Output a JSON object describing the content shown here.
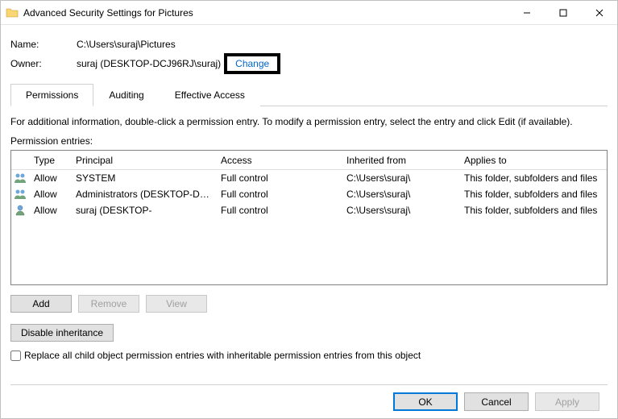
{
  "titlebar": {
    "title": "Advanced Security Settings for Pictures"
  },
  "info": {
    "name_label": "Name:",
    "name_value": "C:\\Users\\suraj\\Pictures",
    "owner_label": "Owner:",
    "owner_value": "suraj (DESKTOP-DCJ96RJ\\suraj)",
    "change_label": "Change"
  },
  "tabs": {
    "permissions": "Permissions",
    "auditing": "Auditing",
    "effective": "Effective Access"
  },
  "instructions": "For additional information, double-click a permission entry. To modify a permission entry, select the entry and click Edit (if available).",
  "list_label": "Permission entries:",
  "columns": {
    "type": "Type",
    "principal": "Principal",
    "access": "Access",
    "inherited": "Inherited from",
    "applies": "Applies to"
  },
  "entries": [
    {
      "icon": "group",
      "type": "Allow",
      "principal": "SYSTEM",
      "access": "Full control",
      "inherited": "C:\\Users\\suraj\\",
      "applies": "This folder, subfolders and files"
    },
    {
      "icon": "group",
      "type": "Allow",
      "principal": "Administrators (DESKTOP-DC...",
      "access": "Full control",
      "inherited": "C:\\Users\\suraj\\",
      "applies": "This folder, subfolders and files"
    },
    {
      "icon": "user",
      "type": "Allow",
      "principal": "suraj (DESKTOP-",
      "access": "Full control",
      "inherited": "C:\\Users\\suraj\\",
      "applies": "This folder, subfolders and files"
    }
  ],
  "buttons": {
    "add": "Add",
    "remove": "Remove",
    "view": "View",
    "disable_inherit": "Disable inheritance",
    "ok": "OK",
    "cancel": "Cancel",
    "apply": "Apply"
  },
  "checkbox_label": "Replace all child object permission entries with inheritable permission entries from this object"
}
